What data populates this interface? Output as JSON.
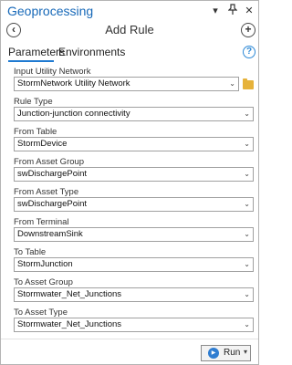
{
  "window": {
    "title": "Geoprocessing",
    "icons": {
      "dropdown": "chevron-down-icon",
      "pin": "pin-icon",
      "close": "close-icon"
    }
  },
  "header": {
    "title": "Add Rule",
    "back_icon": "back-arrow-icon",
    "add_icon": "add-plus-icon"
  },
  "tabs": [
    {
      "label": "Parameters",
      "active": true
    },
    {
      "label": "Environments",
      "active": false
    }
  ],
  "help_icon": "help-icon",
  "fields": [
    {
      "label": "Input Utility Network",
      "value": "StormNetwork Utility Network",
      "has_browse": true
    },
    {
      "label": "Rule Type",
      "value": "Junction-junction connectivity"
    },
    {
      "label": "From Table",
      "value": "StormDevice"
    },
    {
      "label": "From Asset Group",
      "value": "swDischargePoint"
    },
    {
      "label": "From Asset Type",
      "value": "swDischargePoint"
    },
    {
      "label": "From Terminal",
      "value": "DownstreamSink"
    },
    {
      "label": "To Table",
      "value": "StormJunction"
    },
    {
      "label": "To Asset Group",
      "value": "Stormwater_Net_Junctions"
    },
    {
      "label": "To Asset Type",
      "value": "Stormwater_Net_Junctions"
    }
  ],
  "footer": {
    "run_label": "Run"
  },
  "colors": {
    "accent": "#1f7ad1",
    "title": "#1668b8",
    "folder": "#e6b23a"
  }
}
